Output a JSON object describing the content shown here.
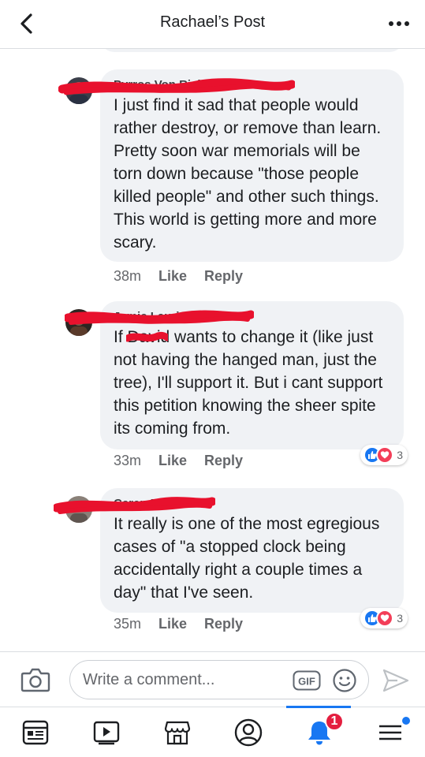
{
  "header": {
    "title": "Rachael’s Post",
    "back_icon": "chevron-left-icon",
    "more_icon": "more-dots-icon"
  },
  "comments": [
    {
      "author": "Pyrros Von Richthofen",
      "author_redacted": true,
      "text": "I just find it sad that people would rather destroy, or remove than learn.  Pretty soon war memorials will be torn down because \"those people killed people\" and other such things.  This world is getting more and more scary.",
      "time": "38m",
      "like_label": "Like",
      "reply_label": "Reply",
      "reactions": null
    },
    {
      "author": "Jamie Laurieysen",
      "author_redacted": true,
      "text_before": "If ",
      "text_redacted_word": "David",
      "text_after": " wants to change it (like just not having the hanged man, just the tree), I'll support it. But i cant support this petition knowing the sheer spite its coming from.",
      "time": "33m",
      "like_label": "Like",
      "reply_label": "Reply",
      "reactions": {
        "count": "3",
        "types": [
          "like",
          "love"
        ]
      }
    },
    {
      "author": "Ceren Ercen",
      "author_redacted": true,
      "text": "It really is one of the most egregious cases of \"a stopped clock being accidentally right a couple times a day\" that I've seen.",
      "time": "35m",
      "like_label": "Like",
      "reply_label": "Reply",
      "reactions": {
        "count": "3",
        "types": [
          "like",
          "love"
        ]
      }
    }
  ],
  "composer": {
    "placeholder": "Write a comment...",
    "gif_label": "GIF",
    "camera_icon": "camera-icon",
    "emoji_icon": "emoji-icon",
    "send_icon": "send-icon"
  },
  "bottom_nav": {
    "items": [
      "news-feed-icon",
      "watch-icon",
      "marketplace-icon",
      "profile-icon",
      "notifications-icon",
      "menu-icon"
    ],
    "active": "notifications-icon",
    "notification_badge": "1"
  },
  "colors": {
    "accent": "#1877f2",
    "bubble": "#f0f2f5",
    "secondary_text": "#65676b",
    "redaction": "#e8112d",
    "love": "#f33e58",
    "badge": "#e41e3f"
  }
}
